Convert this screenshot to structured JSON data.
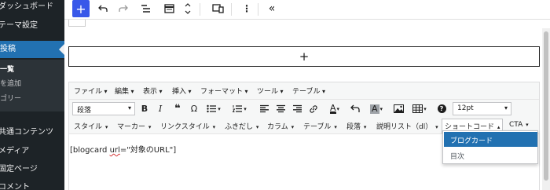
{
  "sidebar": {
    "items": [
      {
        "label": "ダッシュボード"
      },
      {
        "label": "テーマ設定"
      },
      {
        "label": "投稿"
      },
      {
        "label": "共通コンテンツ"
      },
      {
        "label": "メディア"
      },
      {
        "label": "固定ページ"
      },
      {
        "label": "コメント"
      }
    ],
    "subitems": [
      {
        "label": "一覧"
      },
      {
        "label": "を追加"
      },
      {
        "label": "ゴリー"
      }
    ]
  },
  "topbar": {
    "icons": [
      "plus-icon",
      "undo-icon",
      "redo-icon",
      "list-view-icon",
      "block-navigation-icon",
      "move-updown-icon",
      "responsive-preview-icon",
      "more-options-icon",
      "collapse-icon"
    ]
  },
  "canvas": {
    "appender_symbol": "+"
  },
  "classic": {
    "menubar": [
      "ファイル",
      "編集",
      "表示",
      "挿入",
      "フォーマット",
      "ツール",
      "テーブル"
    ],
    "toolbar1": {
      "format_select": "段落",
      "font_size_select": "12pt",
      "bold": "B",
      "italic": "I",
      "blockquote": "❝",
      "omega": "Ω",
      "text_color": "A",
      "background_color": "A"
    },
    "toolbar2": [
      "スタイル",
      "マーカー",
      "リンクスタイル",
      "ふきだし",
      "カラム",
      "テーブル",
      "段落",
      "説明リスト（dl）",
      "ショートコード",
      "CTA"
    ],
    "content": {
      "prefix": "[blogcard ",
      "underlined": "url",
      "suffix": "=\"対象のURL\"]"
    }
  },
  "dropdown": {
    "items": [
      {
        "label": "ブログカード",
        "highlighted": true
      },
      {
        "label": "目次",
        "highlighted": false
      }
    ]
  },
  "colors": {
    "sidebar_bg": "#1d2327",
    "accent": "#2271b1",
    "inserter_blue": "#3858e9"
  }
}
